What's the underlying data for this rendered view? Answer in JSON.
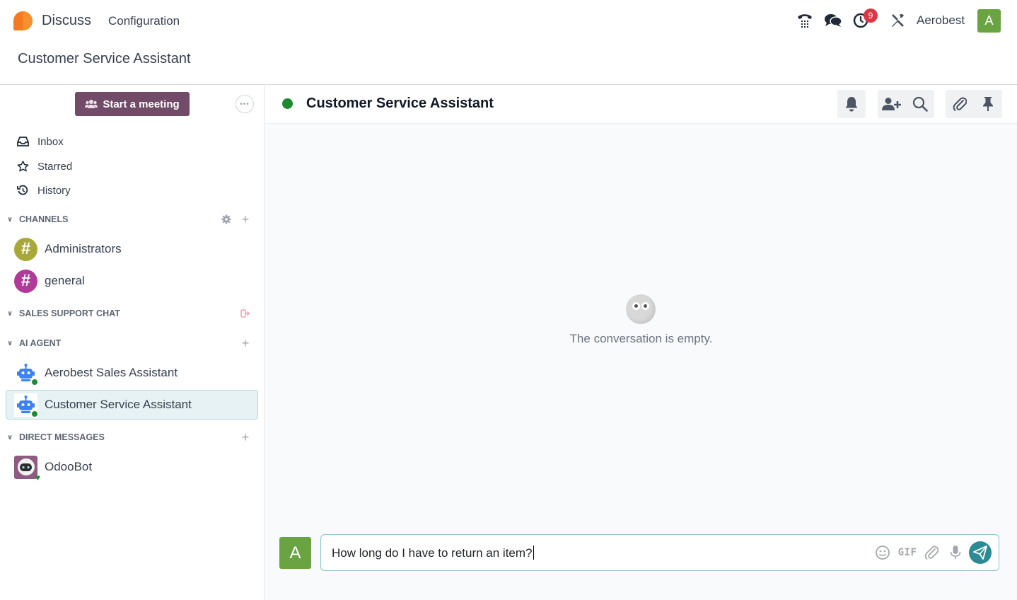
{
  "navbar": {
    "app_name": "Discuss",
    "menu_config": "Configuration",
    "activity_count": "9",
    "company": "Aerobest",
    "user_initial": "A",
    "icons": [
      "phone-icon",
      "chat-icon",
      "clock-icon",
      "tools-icon"
    ]
  },
  "breadcrumb": "Customer Service Assistant",
  "sidebar": {
    "meeting_button": "Start a meeting",
    "mailboxes": [
      {
        "label": "Inbox",
        "icon": "inbox-icon"
      },
      {
        "label": "Starred",
        "icon": "star-icon"
      },
      {
        "label": "History",
        "icon": "history-icon"
      }
    ],
    "categories": {
      "channels": "CHANNELS",
      "sales_support": "SALES SUPPORT CHAT",
      "ai_agent": "AI AGENT",
      "direct_messages": "DIRECT MESSAGES"
    },
    "channels": [
      {
        "name": "Administrators",
        "color": "#a8a83a"
      },
      {
        "name": "general",
        "color": "#b03a9a"
      }
    ],
    "ai_agents": [
      {
        "name": "Aerobest Sales Assistant"
      },
      {
        "name": "Customer Service Assistant",
        "active": true
      }
    ],
    "direct_messages": [
      {
        "name": "OdooBot"
      }
    ]
  },
  "thread": {
    "title": "Customer Service Assistant",
    "empty_message": "The conversation is empty."
  },
  "composer": {
    "avatar_initial": "A",
    "text": "How long do I have to return an item?",
    "gif_label": "GIF"
  },
  "colors": {
    "brand": "#714b67",
    "accent": "#2b8c96",
    "online": "#1e8a30",
    "avatar": "#6aa342",
    "badge": "#dc3545"
  }
}
